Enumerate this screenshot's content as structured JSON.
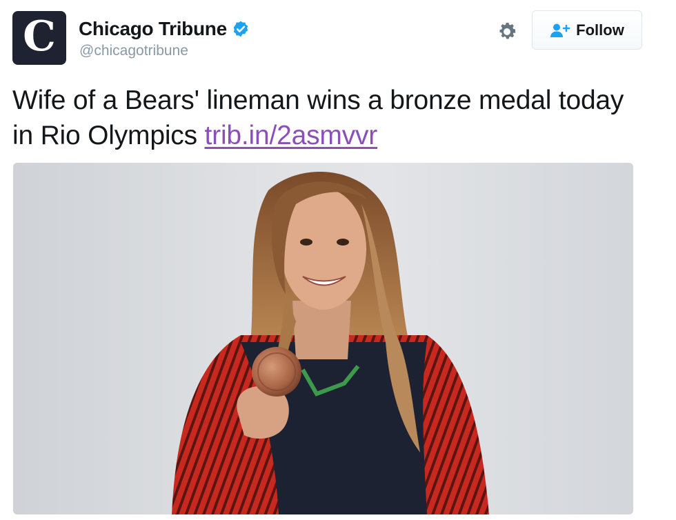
{
  "account": {
    "display_name": "Chicago Tribune",
    "handle": "@chicagotribune",
    "avatar_letter": "C",
    "verified": true
  },
  "actions": {
    "settings_icon": "gear-icon",
    "follow_icon": "add-user-icon",
    "follow_label": "Follow"
  },
  "tweet": {
    "text": "Wife of a Bears' lineman wins a bronze medal today in Rio Olympics ",
    "link_text": "trib.in/2asmvvr"
  },
  "colors": {
    "verified_blue": "#1da1f2",
    "follow_icon_blue": "#1da1f2",
    "link_purple": "#8b4fb8"
  }
}
